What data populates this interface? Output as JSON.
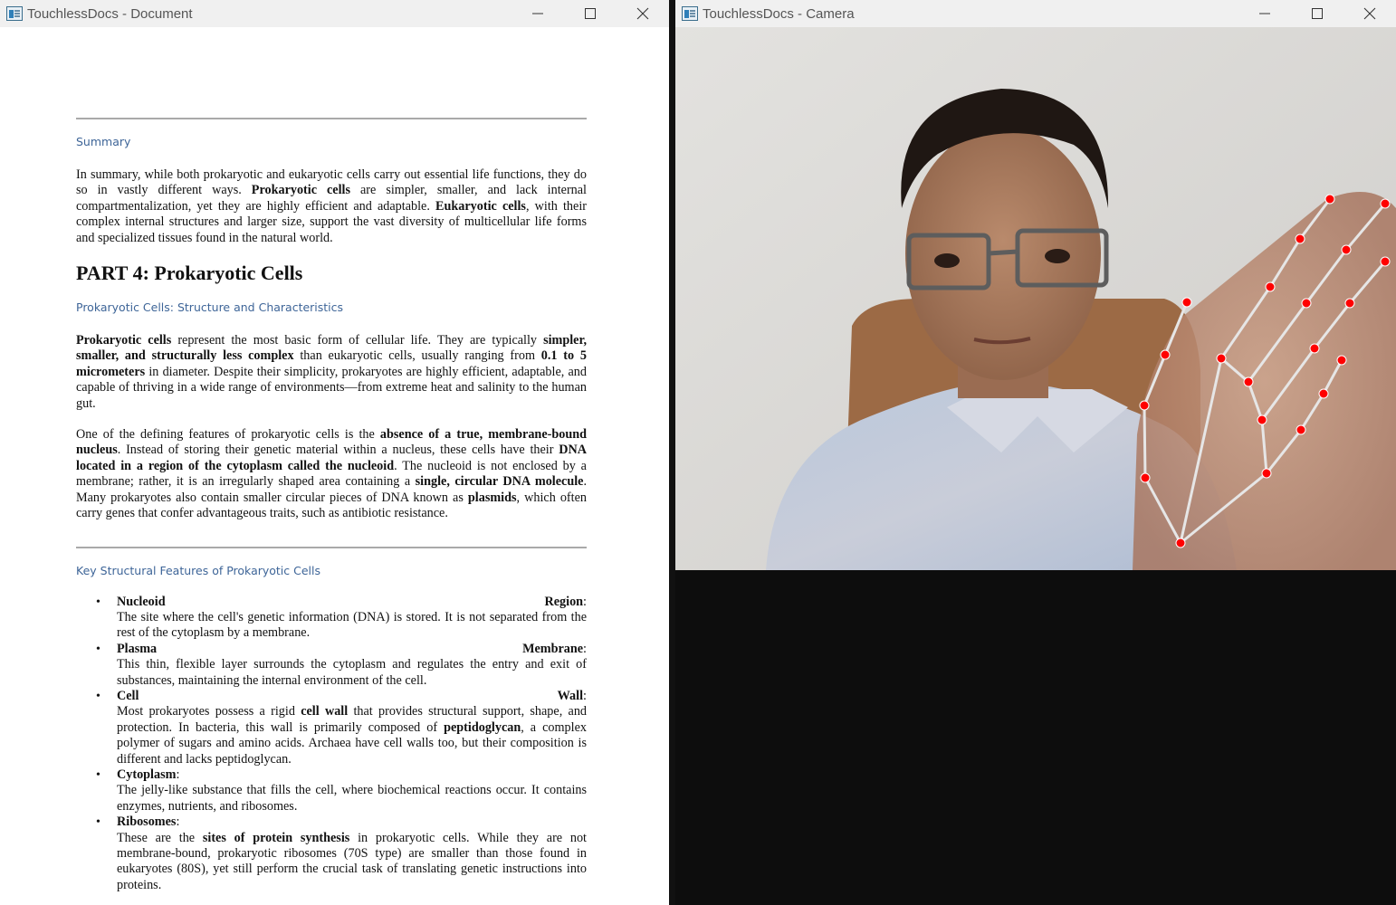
{
  "document_window": {
    "title": "TouchlessDocs - Document",
    "controls": [
      "minimize",
      "maximize",
      "close"
    ],
    "summary_heading": "Summary",
    "summary_text": {
      "s1": "In summary, while both prokaryotic and eukaryotic cells carry out essential life functions, they do so in vastly different ways. ",
      "b1": "Prokaryotic cells",
      "s2": " are simpler, smaller, and lack internal compartmentalization, yet they are highly efficient and adaptable. ",
      "b2": "Eukaryotic cells",
      "s3": ", with their complex internal structures and larger size, support the vast diversity of multicellular life forms and specialized tissues found in the natural world."
    },
    "part_title": "PART 4: Prokaryotic Cells",
    "section_heading": "Prokaryotic Cells: Structure and Characteristics",
    "para1": {
      "b1": "Prokaryotic cells",
      "s1": " represent the most basic form of cellular life. They are typically ",
      "b2": "simpler, smaller, and structurally less complex",
      "s2": " than eukaryotic cells, usually ranging from ",
      "b3": "0.1 to 5 micrometers",
      "s3": " in diameter. Despite their simplicity, prokaryotes are highly efficient, adaptable, and capable of thriving in a wide range of environments—from extreme heat and salinity to the human gut."
    },
    "para2": {
      "s1": "One of the defining features of prokaryotic cells is the ",
      "b1": "absence of a true, membrane-bound nucleus",
      "s2": ". Instead of storing their genetic material within a nucleus, these cells have their ",
      "b2": "DNA located in a region of the cytoplasm called the nucleoid",
      "s3": ". The nucleoid is not enclosed by a membrane; rather, it is an irregularly shaped area containing a ",
      "b3": "single, circular DNA molecule",
      "s4": ". Many prokaryotes also contain smaller circular pieces of DNA known as ",
      "b4": "plasmids",
      "s5": ", which often carry genes that confer advantageous traits, such as antibiotic resistance."
    },
    "features_heading": "Key Structural Features of Prokaryotic Cells",
    "features": [
      {
        "t1": "Nucleoid",
        "t2": "Region",
        "colon": ":",
        "desc": "The site where the cell's genetic information (DNA) is stored. It is not separated from the rest of the cytoplasm by a membrane."
      },
      {
        "t1": "Plasma",
        "t2": "Membrane",
        "colon": ":",
        "desc": "This thin, flexible layer surrounds the cytoplasm and regulates the entry and exit of substances, maintaining the internal environment of the cell."
      },
      {
        "t1": "Cell",
        "t2": "Wall",
        "colon": ":",
        "d1": "Most prokaryotes possess a rigid ",
        "db1": "cell wall",
        "d2": " that provides structural support, shape, and protection. In bacteria, this wall is primarily composed of ",
        "db2": "peptidoglycan",
        "d3": ", a complex polymer of sugars and amino acids. Archaea have cell walls too, but their composition is different and lacks peptidoglycan."
      },
      {
        "t1": "Cytoplasm",
        "t2": "",
        "colon": ":",
        "desc": "The jelly-like substance that fills the cell, where biochemical reactions occur. It contains enzymes, nutrients, and ribosomes."
      },
      {
        "t1": "Ribosomes",
        "t2": "",
        "colon": ":",
        "d1": "These are the ",
        "db1": "sites of protein synthesis",
        "d2": " in prokaryotic cells. While they are not membrane-bound, prokaryotic ribosomes (70S type) are smaller than those found in eukaryotes (80S), yet still perform the crucial task of translating genetic instructions into proteins."
      }
    ]
  },
  "camera_window": {
    "title": "TouchlessDocs - Camera",
    "controls": [
      "minimize",
      "maximize",
      "close"
    ],
    "hand_landmark_color": "#ff0000",
    "hand_connection_color": "#e6e6e6"
  }
}
